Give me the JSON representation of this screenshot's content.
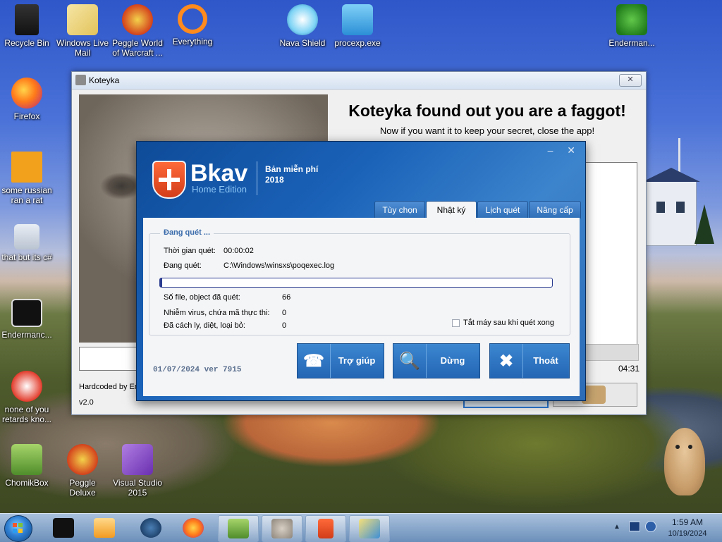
{
  "desktop": {
    "icons": [
      {
        "label": "Recycle Bin"
      },
      {
        "label": "Windows Live Mail"
      },
      {
        "label": "Peggle World of Warcraft ..."
      },
      {
        "label": "Everything"
      },
      {
        "label": "Nava Shield"
      },
      {
        "label": "procexp.exe"
      },
      {
        "label": "Enderman..."
      },
      {
        "label": "Firefox"
      },
      {
        "label": "some russian ran a rat"
      },
      {
        "label": "that but its c#"
      },
      {
        "label": "Endermanc..."
      },
      {
        "label": "none of you retards kno..."
      },
      {
        "label": "ChomikBox"
      },
      {
        "label": "Peggle Deluxe"
      },
      {
        "label": "Visual Studio 2015"
      }
    ]
  },
  "koteyka": {
    "title": "Koteyka",
    "close_label": "✕",
    "headline": "Koteyka found out you are a faggot!",
    "subline": "Now if you want it to keep your secret, close the app!",
    "timer": "04:31",
    "hardcoded": "Hardcoded by En",
    "version": "v2.0"
  },
  "bkav": {
    "window_controls": "– ✕",
    "brand": "Bkav",
    "edition": "Home Edition",
    "free_label": "Bản miễn phí",
    "year": "2018",
    "tabs": [
      {
        "label": "Tùy chọn"
      },
      {
        "label": "Nhật ký"
      },
      {
        "label": "Lịch quét"
      },
      {
        "label": "Nâng cấp"
      }
    ],
    "active_tab": "Nhật ký",
    "scan": {
      "group_title": "Đang quét ...",
      "time_label": "Thời gian quét:",
      "time_value": "00:00:02",
      "scanning_label": "Đang quét:",
      "scanning_value": "C:\\Windows\\winsxs\\poqexec.log",
      "progress": 0.005,
      "files_label": "Số file, object đã quét:",
      "files_value": "66",
      "virus_label": "Nhiễm virus, chứa mã thực thi:",
      "virus_value": "0",
      "quarantine_label": "Đã cách ly, diệt, loại bỏ:",
      "quarantine_value": "0",
      "shutdown_label": "Tắt máy sau khi quét xong"
    },
    "version_text": "01/07/2024 ver 7915",
    "buttons": {
      "help": "Trợ giúp",
      "stop": "Dừng",
      "exit": "Thoát"
    }
  },
  "taskbar": {
    "time": "1:59 AM",
    "date": "10/19/2024",
    "tray_arrow": "▲"
  },
  "colors": {
    "bkav_blue": "#1a62b8",
    "bkav_accent": "#3b6cab",
    "taskbar": "#8aa8cc"
  }
}
